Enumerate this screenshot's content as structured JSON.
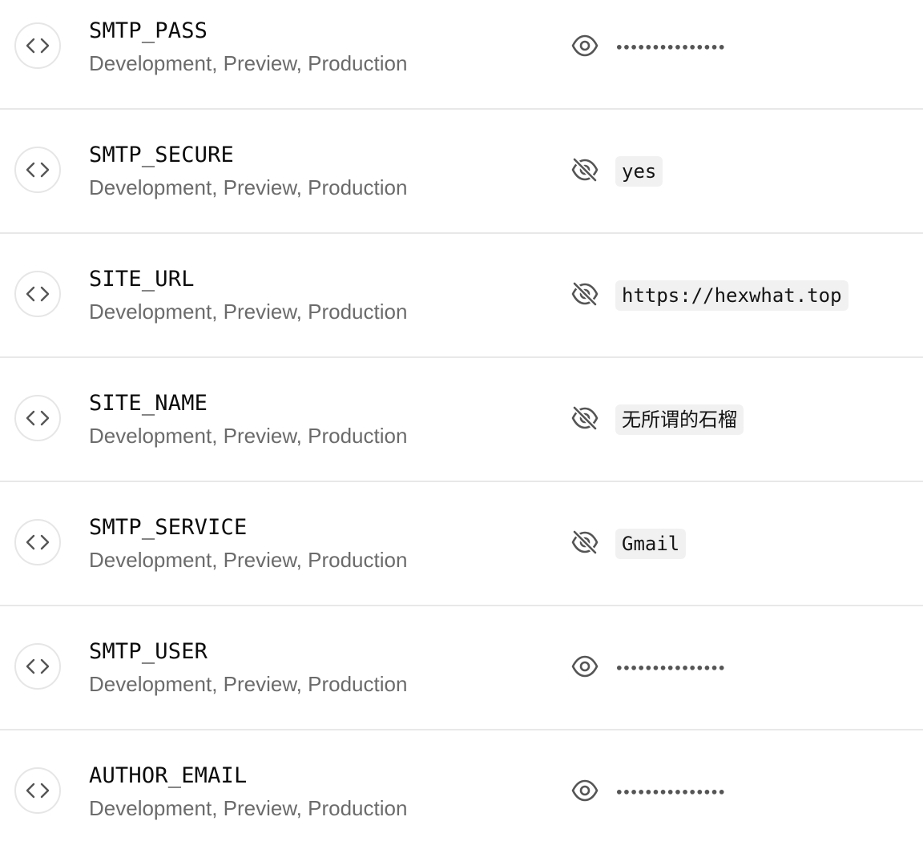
{
  "variables": [
    {
      "name": "SMTP_PASS",
      "targets": "Development, Preview, Production",
      "visible": false,
      "value": "•••••••••••••••"
    },
    {
      "name": "SMTP_SECURE",
      "targets": "Development, Preview, Production",
      "visible": true,
      "value": "yes"
    },
    {
      "name": "SITE_URL",
      "targets": "Development, Preview, Production",
      "visible": true,
      "value": "https://hexwhat.top"
    },
    {
      "name": "SITE_NAME",
      "targets": "Development, Preview, Production",
      "visible": true,
      "value": "无所谓的石榴"
    },
    {
      "name": "SMTP_SERVICE",
      "targets": "Development, Preview, Production",
      "visible": true,
      "value": "Gmail"
    },
    {
      "name": "SMTP_USER",
      "targets": "Development, Preview, Production",
      "visible": false,
      "value": "•••••••••••••••"
    },
    {
      "name": "AUTHOR_EMAIL",
      "targets": "Development, Preview, Production",
      "visible": false,
      "value": "•••••••••••••••"
    }
  ],
  "icons": {
    "type": "code-brackets-icon",
    "show": "eye-icon",
    "hide": "eye-off-icon"
  },
  "colors": {
    "icon": "#555555",
    "divider": "#e8e8e8",
    "value_bg": "#f1f1f1",
    "muted_text": "#6b6b6b"
  }
}
